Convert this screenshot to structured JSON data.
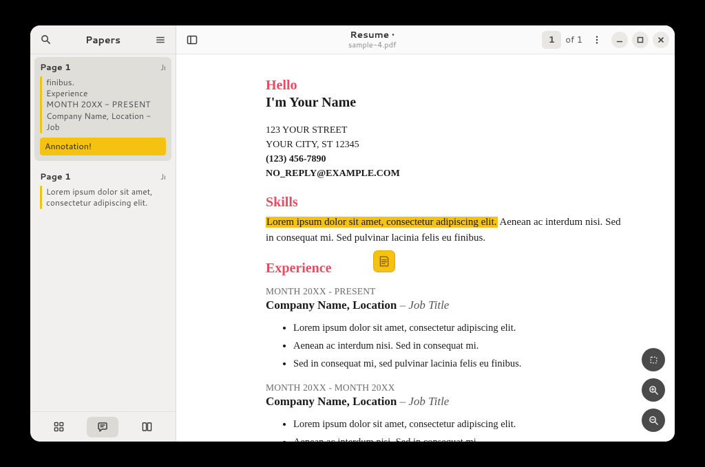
{
  "sidebar": {
    "title": "Papers",
    "annotations": [
      {
        "page": "Page 1",
        "date": "Jı",
        "quote": "finibus.\nExperience\nMONTH 20XX - PRESENT\nCompany Name, Location - Job",
        "note": "Annotation!",
        "selected": true
      },
      {
        "page": "Page 1",
        "date": "Jı",
        "quote": "Lorem ipsum dolor sit amet, consectetur adipiscing elit.",
        "note": null,
        "selected": false
      }
    ]
  },
  "header": {
    "title": "Resume •",
    "subtitle": "sample-4.pdf",
    "page_cur": "1",
    "page_of": "of 1"
  },
  "doc": {
    "hello": "Hello",
    "name": "I'm Your Name",
    "street": "123 YOUR STREET",
    "city": "YOUR CITY, ST 12345",
    "phone": "(123) 456-7890",
    "email": "NO_REPLY@EXAMPLE.COM",
    "skills_h": "Skills",
    "skills_hl": "Lorem ipsum dolor sit amet, consectetur adipiscing elit.",
    "skills_rest": " Aenean ac interdum nisi. Sed in consequat mi. Sed pulvinar lacinia felis eu finibus.",
    "exp_h": "Experience",
    "jobs": [
      {
        "dates": "MONTH 20XX - PRESENT",
        "company": "Company Name, Location",
        "sep": " – ",
        "title": "Job Title",
        "bullets": [
          "Lorem ipsum dolor sit amet, consectetur adipiscing elit.",
          "Aenean ac interdum nisi. Sed in consequat mi.",
          "Sed in consequat mi, sed pulvinar lacinia felis eu finibus."
        ]
      },
      {
        "dates": "MONTH 20XX - MONTH 20XX",
        "company": "Company Name, Location",
        "sep": " – ",
        "title": "Job Title",
        "bullets": [
          "Lorem ipsum dolor sit amet, consectetur adipiscing elit.",
          "Aenean ac interdum nisi. Sed in consequat mi."
        ]
      }
    ]
  }
}
